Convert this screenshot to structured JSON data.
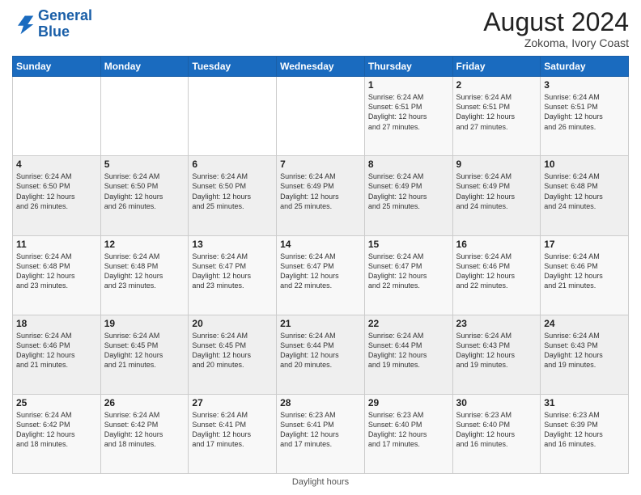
{
  "header": {
    "logo_line1": "General",
    "logo_line2": "Blue",
    "month_year": "August 2024",
    "location": "Zokoma, Ivory Coast"
  },
  "footer": {
    "text": "Daylight hours"
  },
  "days_of_week": [
    "Sunday",
    "Monday",
    "Tuesday",
    "Wednesday",
    "Thursday",
    "Friday",
    "Saturday"
  ],
  "weeks": [
    [
      {
        "num": "",
        "info": ""
      },
      {
        "num": "",
        "info": ""
      },
      {
        "num": "",
        "info": ""
      },
      {
        "num": "",
        "info": ""
      },
      {
        "num": "1",
        "info": "Sunrise: 6:24 AM\nSunset: 6:51 PM\nDaylight: 12 hours\nand 27 minutes."
      },
      {
        "num": "2",
        "info": "Sunrise: 6:24 AM\nSunset: 6:51 PM\nDaylight: 12 hours\nand 27 minutes."
      },
      {
        "num": "3",
        "info": "Sunrise: 6:24 AM\nSunset: 6:51 PM\nDaylight: 12 hours\nand 26 minutes."
      }
    ],
    [
      {
        "num": "4",
        "info": "Sunrise: 6:24 AM\nSunset: 6:50 PM\nDaylight: 12 hours\nand 26 minutes."
      },
      {
        "num": "5",
        "info": "Sunrise: 6:24 AM\nSunset: 6:50 PM\nDaylight: 12 hours\nand 26 minutes."
      },
      {
        "num": "6",
        "info": "Sunrise: 6:24 AM\nSunset: 6:50 PM\nDaylight: 12 hours\nand 25 minutes."
      },
      {
        "num": "7",
        "info": "Sunrise: 6:24 AM\nSunset: 6:49 PM\nDaylight: 12 hours\nand 25 minutes."
      },
      {
        "num": "8",
        "info": "Sunrise: 6:24 AM\nSunset: 6:49 PM\nDaylight: 12 hours\nand 25 minutes."
      },
      {
        "num": "9",
        "info": "Sunrise: 6:24 AM\nSunset: 6:49 PM\nDaylight: 12 hours\nand 24 minutes."
      },
      {
        "num": "10",
        "info": "Sunrise: 6:24 AM\nSunset: 6:48 PM\nDaylight: 12 hours\nand 24 minutes."
      }
    ],
    [
      {
        "num": "11",
        "info": "Sunrise: 6:24 AM\nSunset: 6:48 PM\nDaylight: 12 hours\nand 23 minutes."
      },
      {
        "num": "12",
        "info": "Sunrise: 6:24 AM\nSunset: 6:48 PM\nDaylight: 12 hours\nand 23 minutes."
      },
      {
        "num": "13",
        "info": "Sunrise: 6:24 AM\nSunset: 6:47 PM\nDaylight: 12 hours\nand 23 minutes."
      },
      {
        "num": "14",
        "info": "Sunrise: 6:24 AM\nSunset: 6:47 PM\nDaylight: 12 hours\nand 22 minutes."
      },
      {
        "num": "15",
        "info": "Sunrise: 6:24 AM\nSunset: 6:47 PM\nDaylight: 12 hours\nand 22 minutes."
      },
      {
        "num": "16",
        "info": "Sunrise: 6:24 AM\nSunset: 6:46 PM\nDaylight: 12 hours\nand 22 minutes."
      },
      {
        "num": "17",
        "info": "Sunrise: 6:24 AM\nSunset: 6:46 PM\nDaylight: 12 hours\nand 21 minutes."
      }
    ],
    [
      {
        "num": "18",
        "info": "Sunrise: 6:24 AM\nSunset: 6:46 PM\nDaylight: 12 hours\nand 21 minutes."
      },
      {
        "num": "19",
        "info": "Sunrise: 6:24 AM\nSunset: 6:45 PM\nDaylight: 12 hours\nand 21 minutes."
      },
      {
        "num": "20",
        "info": "Sunrise: 6:24 AM\nSunset: 6:45 PM\nDaylight: 12 hours\nand 20 minutes."
      },
      {
        "num": "21",
        "info": "Sunrise: 6:24 AM\nSunset: 6:44 PM\nDaylight: 12 hours\nand 20 minutes."
      },
      {
        "num": "22",
        "info": "Sunrise: 6:24 AM\nSunset: 6:44 PM\nDaylight: 12 hours\nand 19 minutes."
      },
      {
        "num": "23",
        "info": "Sunrise: 6:24 AM\nSunset: 6:43 PM\nDaylight: 12 hours\nand 19 minutes."
      },
      {
        "num": "24",
        "info": "Sunrise: 6:24 AM\nSunset: 6:43 PM\nDaylight: 12 hours\nand 19 minutes."
      }
    ],
    [
      {
        "num": "25",
        "info": "Sunrise: 6:24 AM\nSunset: 6:42 PM\nDaylight: 12 hours\nand 18 minutes."
      },
      {
        "num": "26",
        "info": "Sunrise: 6:24 AM\nSunset: 6:42 PM\nDaylight: 12 hours\nand 18 minutes."
      },
      {
        "num": "27",
        "info": "Sunrise: 6:24 AM\nSunset: 6:41 PM\nDaylight: 12 hours\nand 17 minutes."
      },
      {
        "num": "28",
        "info": "Sunrise: 6:23 AM\nSunset: 6:41 PM\nDaylight: 12 hours\nand 17 minutes."
      },
      {
        "num": "29",
        "info": "Sunrise: 6:23 AM\nSunset: 6:40 PM\nDaylight: 12 hours\nand 17 minutes."
      },
      {
        "num": "30",
        "info": "Sunrise: 6:23 AM\nSunset: 6:40 PM\nDaylight: 12 hours\nand 16 minutes."
      },
      {
        "num": "31",
        "info": "Sunrise: 6:23 AM\nSunset: 6:39 PM\nDaylight: 12 hours\nand 16 minutes."
      }
    ]
  ]
}
